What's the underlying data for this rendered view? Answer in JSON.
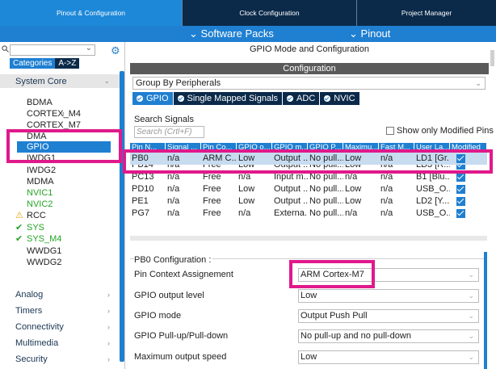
{
  "top_tabs": [
    "Pinout & Configuration",
    "Clock Configuration",
    "Project Manager"
  ],
  "menus": [
    "Software Packs",
    "Pinout"
  ],
  "left": {
    "search_placeholder": "",
    "category_tabs": [
      "Categories",
      "A->Z"
    ],
    "system_core_label": "System Core",
    "system_core_items": [
      {
        "label": "BDMA",
        "color": "normal"
      },
      {
        "label": "CORTEX_M4",
        "color": "normal"
      },
      {
        "label": "CORTEX_M7",
        "color": "normal"
      },
      {
        "label": "DMA",
        "color": "normal"
      },
      {
        "label": "GPIO",
        "color": "selected"
      },
      {
        "label": "IWDG1",
        "color": "normal"
      },
      {
        "label": "IWDG2",
        "color": "normal"
      },
      {
        "label": "MDMA",
        "color": "normal"
      },
      {
        "label": "NVIC1",
        "color": "green"
      },
      {
        "label": "NVIC2",
        "color": "green"
      },
      {
        "label": "RCC",
        "color": "warning"
      },
      {
        "label": "SYS",
        "color": "green-check"
      },
      {
        "label": "SYS_M4",
        "color": "green-check"
      },
      {
        "label": "WWDG1",
        "color": "normal"
      },
      {
        "label": "WWDG2",
        "color": "normal"
      }
    ],
    "groups": [
      "Analog",
      "Timers",
      "Connectivity",
      "Multimedia",
      "Security"
    ]
  },
  "right": {
    "title": "GPIO Mode and Configuration",
    "config_label": "Configuration",
    "group_by": "Group By Peripherals",
    "filter_tabs": [
      "GPIO",
      "Single Mapped Signals",
      "ADC",
      "NVIC"
    ],
    "search_label": "Search Signals",
    "search_placeholder": "Search (Crtl+F)",
    "show_modified_label": "Show only Modified Pins",
    "table": {
      "headers": [
        "Pin N...",
        "Signal ...",
        "Pin Co...",
        "GPIO o...",
        "GPIO m...",
        "GPIO P...",
        "Maximu...",
        "Fast M...",
        "User La...",
        "Modified"
      ],
      "rows": [
        {
          "cells": [
            "PB0",
            "n/a",
            "ARM C...",
            "Low",
            "Output ...",
            "No pull...",
            "Low",
            "n/a",
            "LD1 [Gr..."
          ],
          "modified": true
        },
        {
          "cells": [
            "PB14",
            "n/a",
            "Free",
            "Low",
            "Output ...",
            "No pull...",
            "Low",
            "n/a",
            "LD3 [R..."
          ],
          "modified": true
        },
        {
          "cells": [
            "PC13",
            "n/a",
            "Free",
            "n/a",
            "Input m...",
            "No pull...",
            "n/a",
            "n/a",
            "B1 [Blu..."
          ],
          "modified": true
        },
        {
          "cells": [
            "PD10",
            "n/a",
            "Free",
            "Low",
            "Output ...",
            "No pull...",
            "Low",
            "n/a",
            "USB_O..."
          ],
          "modified": true
        },
        {
          "cells": [
            "PE1",
            "n/a",
            "Free",
            "Low",
            "Output ...",
            "No pull...",
            "Low",
            "n/a",
            "LD2 [Y..."
          ],
          "modified": true
        },
        {
          "cells": [
            "PG7",
            "n/a",
            "Free",
            "n/a",
            "Externa...",
            "No pull...",
            "n/a",
            "n/a",
            "USB_O..."
          ],
          "modified": true
        }
      ]
    },
    "pb0": {
      "title": "PB0 Configuration :",
      "fields": [
        {
          "label": "Pin Context Assignement",
          "value": "ARM Cortex-M7"
        },
        {
          "label": "GPIO output level",
          "value": "Low"
        },
        {
          "label": "GPIO mode",
          "value": "Output Push Pull"
        },
        {
          "label": "GPIO Pull-up/Pull-down",
          "value": "No pull-up and no pull-down"
        },
        {
          "label": "Maximum output speed",
          "value": "Low"
        }
      ]
    }
  },
  "colors": {
    "accent": "#1f7fd1",
    "navy": "#0b2a4a",
    "highlight": "#e0198b",
    "green": "#24a324"
  }
}
